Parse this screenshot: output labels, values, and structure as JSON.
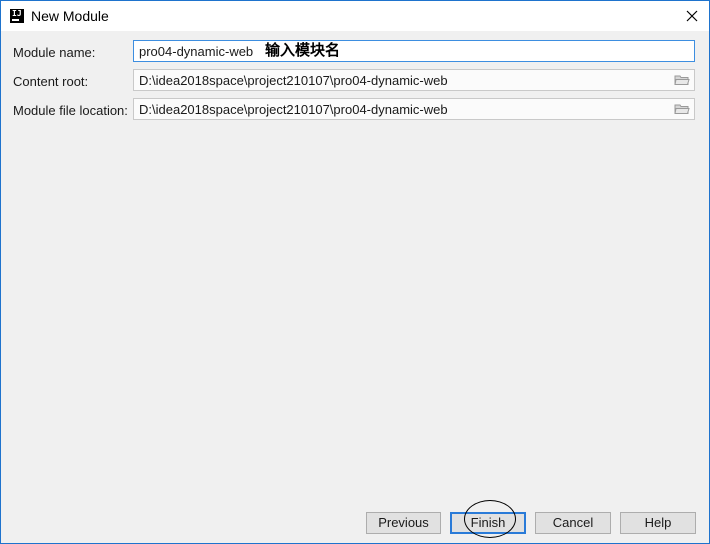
{
  "window": {
    "title": "New Module",
    "icon_name": "intellij-idea-icon",
    "accent_color": "#1e73cd"
  },
  "form": {
    "module_name": {
      "label": "Module name:",
      "value": "pro04-dynamic-web"
    },
    "annotation": "输入模块名",
    "content_root": {
      "label": "Content root:",
      "value": "D:\\idea2018space\\project210107\\pro04-dynamic-web"
    },
    "module_file_location": {
      "label": "Module file location:",
      "value": "D:\\idea2018space\\project210107\\pro04-dynamic-web"
    }
  },
  "buttons": {
    "previous": "Previous",
    "finish": "Finish",
    "cancel": "Cancel",
    "help": "Help"
  }
}
